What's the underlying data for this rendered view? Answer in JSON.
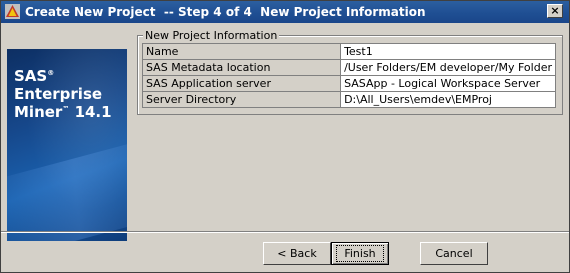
{
  "window": {
    "title": "Create New Project  -- Step 4 of 4  New Project Information",
    "close_label": "×"
  },
  "brand": {
    "line1": "SAS",
    "line1_mark": "®",
    "line2": "Enterprise",
    "line3": "Miner",
    "line3_mark": "™",
    "version": "14.1"
  },
  "group": {
    "label": "New Project Information",
    "rows": [
      {
        "key": "Name",
        "value": "Test1"
      },
      {
        "key": "SAS Metadata location",
        "value": "/User Folders/EM developer/My Folder"
      },
      {
        "key": "SAS Application server",
        "value": "SASApp - Logical Workspace Server"
      },
      {
        "key": "Server Directory",
        "value": "D:\\All_Users\\emdev\\EMProj"
      }
    ]
  },
  "buttons": {
    "back": "< Back",
    "finish": "Finish",
    "cancel": "Cancel"
  }
}
